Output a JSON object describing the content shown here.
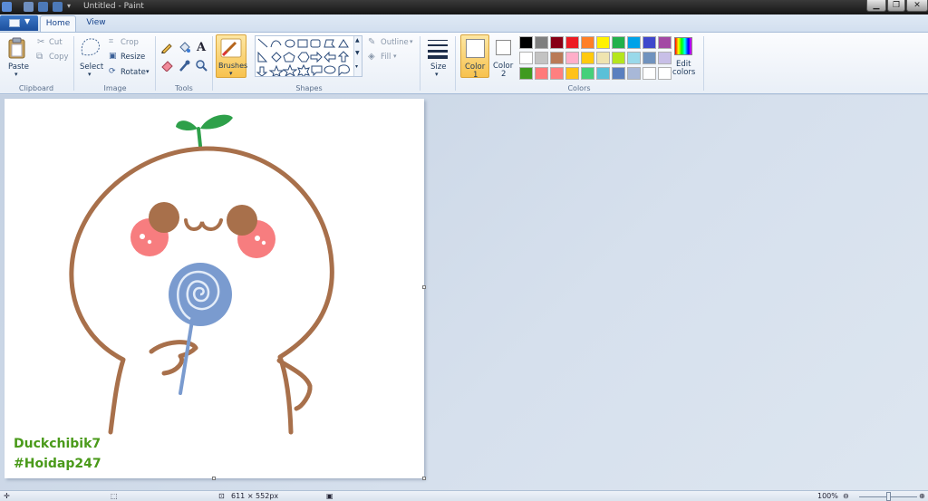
{
  "window": {
    "title": "Untitled - Paint"
  },
  "tabs": [
    {
      "label": "Home",
      "active": true
    },
    {
      "label": "View",
      "active": false
    }
  ],
  "clipboard": {
    "paste": "Paste",
    "cut": "Cut",
    "copy": "Copy",
    "group": "Clipboard"
  },
  "image": {
    "select": "Select",
    "crop": "Crop",
    "resize": "Resize",
    "rotate": "Rotate",
    "group": "Image"
  },
  "tools": {
    "group": "Tools",
    "icons": [
      "pencil-icon",
      "fill-icon",
      "text-icon",
      "eraser-icon",
      "color-picker-icon",
      "magnifier-icon"
    ]
  },
  "brushes": {
    "label": "Brushes"
  },
  "shapes": {
    "group": "Shapes",
    "outline": "Outline",
    "fill": "Fill"
  },
  "size": {
    "label": "Size"
  },
  "colors": {
    "group": "Colors",
    "color1_label": "Color",
    "color1_num": "1",
    "color2_label": "Color",
    "color2_num": "2",
    "color1": "#ffffff",
    "color2": "#ffffff",
    "edit_label": "Edit",
    "edit_label2": "colors",
    "palette": [
      [
        "#000000",
        "#7f7f7f",
        "#880015",
        "#ed1c24",
        "#ff7f27",
        "#fff200",
        "#22b14c",
        "#00a2e8",
        "#3f48cc",
        "#a349a4"
      ],
      [
        "#ffffff",
        "#c3c3c3",
        "#b97a57",
        "#ffaec9",
        "#ffc90e",
        "#efe4b0",
        "#b5e61d",
        "#99d9ea",
        "#7092be",
        "#c8bfe7"
      ],
      [
        "#3f9a1f",
        "#ff7a7a",
        "#ff7f7f",
        "#ffc21a",
        "#45d07a",
        "#5ac0d8",
        "#5a7fbf",
        "#a8b8d8",
        "#ffffff",
        "#ffffff"
      ]
    ]
  },
  "canvas": {
    "watermark_line1": "Duckchibik7",
    "watermark_line2": "#Hoidap247",
    "art_colors": {
      "outline": "#a8704b",
      "leaf": "#2ea04a",
      "cheek": "#f77d7f",
      "eye": "#a8704b",
      "lollipop": "#7a9bcf"
    }
  },
  "status": {
    "dimensions": "611 × 552px",
    "zoom": "100%"
  }
}
